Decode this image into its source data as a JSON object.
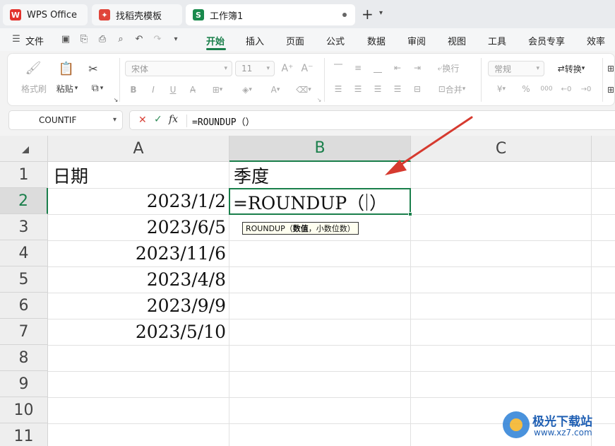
{
  "titlebar": {
    "tabs": [
      {
        "label": "WPS Office",
        "icon": "wps-logo-icon"
      },
      {
        "label": "找稻壳模板",
        "icon": "docer-icon"
      },
      {
        "label": "工作簿1",
        "icon": "spreadsheet-s-icon",
        "icon_text": "S"
      }
    ],
    "new_tab": "+",
    "tab_list_arrow": "⌄"
  },
  "menubar": {
    "file": "文件",
    "tabs": [
      "开始",
      "插入",
      "页面",
      "公式",
      "数据",
      "审阅",
      "视图",
      "工具",
      "会员专享",
      "效率"
    ],
    "active_tab": "开始"
  },
  "ribbon": {
    "format_painter": "格式刷",
    "paste": "粘贴",
    "font_name": "宋体",
    "font_size": "11",
    "wrap": "换行",
    "merge": "合并",
    "number_format": "常规",
    "convert": "转换",
    "bold": "B",
    "italic": "I",
    "underline": "U",
    "currency": "¥",
    "percent": "%",
    "thousands": "000"
  },
  "formula_bar": {
    "name_box": "COUNTIF",
    "cancel": "✕",
    "confirm": "✓",
    "fx": "fx",
    "formula": "=ROUNDUP（）"
  },
  "sheet": {
    "columns": [
      "A",
      "B",
      "C"
    ],
    "rows": [
      "1",
      "2",
      "3",
      "4",
      "5",
      "6",
      "7",
      "8",
      "9",
      "10",
      "11"
    ],
    "cells": {
      "A1": "日期",
      "B1": "季度",
      "A2": "2023/1/2",
      "A3": "2023/6/5",
      "A4": "2023/11/6",
      "A5": "2023/4/8",
      "A6": "2023/9/9",
      "A7": "2023/5/10"
    },
    "editing": {
      "cell": "B2",
      "text_before_caret": "=ROUNDUP（",
      "text_after_caret": "）"
    },
    "tooltip": {
      "func": "ROUNDUP（",
      "arg_bold": "数值",
      "rest": "，小数位数）"
    }
  },
  "annotation": {
    "arrow_color": "#d63a2f"
  },
  "watermark": {
    "title": "极光下载站",
    "url": "www.xz7.com"
  }
}
